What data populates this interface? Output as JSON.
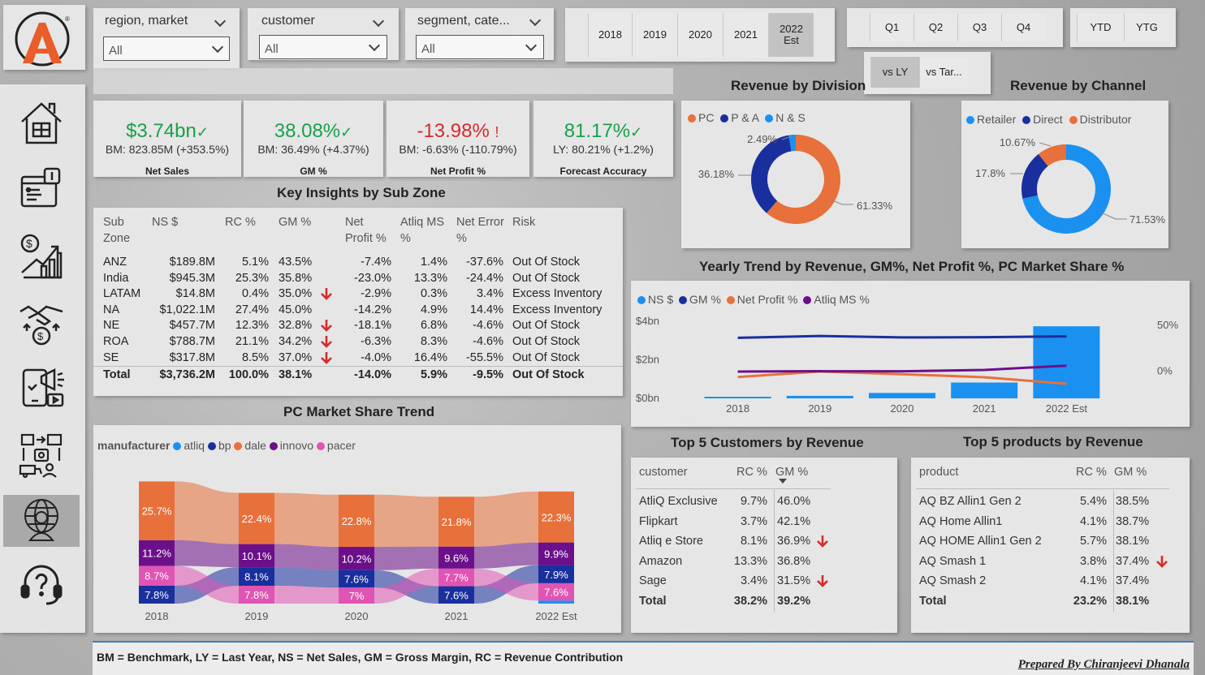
{
  "filters": [
    {
      "label": "region, market",
      "value": "All"
    },
    {
      "label": "customer",
      "value": "All"
    },
    {
      "label": "segment, cate...",
      "value": "All"
    }
  ],
  "years": [
    {
      "label": "2018"
    },
    {
      "label": "2019"
    },
    {
      "label": "2020"
    },
    {
      "label": "2021"
    },
    {
      "label": "2022 Est",
      "selected": true
    }
  ],
  "quarters": [
    "Q1",
    "Q2",
    "Q3",
    "Q4"
  ],
  "ytd": [
    "YTD",
    "YTG"
  ],
  "compare": [
    {
      "label": "vs LY",
      "selected": true
    },
    {
      "label": "vs Tar..."
    }
  ],
  "kpis": [
    {
      "value": "$3.74bn",
      "mark": "✓",
      "sub": "BM: 823.85M (+353.5%)",
      "label": "Net Sales",
      "color": "#17a24a"
    },
    {
      "value": "38.08%",
      "mark": "✓",
      "sub": "BM: 36.49% (+4.37%)",
      "label": "GM %",
      "color": "#17a24a"
    },
    {
      "value": "-13.98%",
      "mark": "!",
      "sub": "BM: -6.63% (-110.79%)",
      "label": "Net Profit %",
      "color": "#d62b2b"
    },
    {
      "value": "81.17%",
      "mark": "✓",
      "sub": "LY: 80.21% (+1.2%)",
      "label": "Forecast Accuracy",
      "color": "#17a24a"
    }
  ],
  "insights": {
    "title": "Key Insights by Sub Zone",
    "headers": [
      "Sub Zone",
      "NS $",
      "RC %",
      "GM %",
      "Net Profit %",
      "Atliq MS %",
      "Net Error %",
      "Risk"
    ],
    "rows": [
      {
        "zone": "ANZ",
        "ns": "$189.8M",
        "rc": "5.1%",
        "gm": "43.5%",
        "np": "-7.4%",
        "ms": "1.4%",
        "ne": "-37.6%",
        "risk": "Out Of Stock",
        "arrow": false
      },
      {
        "zone": "India",
        "ns": "$945.3M",
        "rc": "25.3%",
        "gm": "35.8%",
        "np": "-23.0%",
        "ms": "13.3%",
        "ne": "-24.4%",
        "risk": "Out Of Stock",
        "arrow": false
      },
      {
        "zone": "LATAM",
        "ns": "$14.8M",
        "rc": "0.4%",
        "gm": "35.0%",
        "np": "-2.9%",
        "ms": "0.3%",
        "ne": "3.4%",
        "risk": "Excess Inventory",
        "arrow": true
      },
      {
        "zone": "NA",
        "ns": "$1,022.1M",
        "rc": "27.4%",
        "gm": "45.0%",
        "np": "-14.2%",
        "ms": "4.9%",
        "ne": "14.4%",
        "risk": "Excess Inventory",
        "arrow": false
      },
      {
        "zone": "NE",
        "ns": "$457.7M",
        "rc": "12.3%",
        "gm": "32.8%",
        "np": "-18.1%",
        "ms": "6.8%",
        "ne": "-4.6%",
        "risk": "Out Of Stock",
        "arrow": true
      },
      {
        "zone": "ROA",
        "ns": "$788.7M",
        "rc": "21.1%",
        "gm": "34.2%",
        "np": "-6.3%",
        "ms": "8.3%",
        "ne": "-4.6%",
        "risk": "Out Of Stock",
        "arrow": true
      },
      {
        "zone": "SE",
        "ns": "$317.8M",
        "rc": "8.5%",
        "gm": "37.0%",
        "np": "-4.0%",
        "ms": "16.4%",
        "ne": "-55.5%",
        "risk": "Out Of Stock",
        "arrow": true
      }
    ],
    "total": {
      "zone": "Total",
      "ns": "$3,736.2M",
      "rc": "100.0%",
      "gm": "38.1%",
      "np": "-14.0%",
      "ms": "5.9%",
      "ne": "-9.5%",
      "risk": "Out Of Stock"
    }
  },
  "rev_div": {
    "title": "Revenue by Division"
  },
  "rev_ch": {
    "title": "Revenue by Channel"
  },
  "trend": {
    "title": "Yearly Trend by Revenue, GM%, Net Profit %, PC Market  Share %"
  },
  "share": {
    "title": "PC Market Share Trend",
    "legend_title": "manufacturer"
  },
  "top_customers": {
    "title": "Top 5 Customers by Revenue",
    "headers": [
      "customer",
      "RC %",
      "GM %"
    ],
    "rows": [
      {
        "name": "AtliQ Exclusive",
        "rc": "9.7%",
        "gm": "46.0%",
        "arrow": false
      },
      {
        "name": "Flipkart",
        "rc": "3.7%",
        "gm": "42.1%",
        "arrow": false
      },
      {
        "name": "Atliq e Store",
        "rc": "8.1%",
        "gm": "36.9%",
        "arrow": true
      },
      {
        "name": "Amazon",
        "rc": "13.3%",
        "gm": "36.8%",
        "arrow": false
      },
      {
        "name": "Sage",
        "rc": "3.4%",
        "gm": "31.5%",
        "arrow": true
      }
    ],
    "total": {
      "name": "Total",
      "rc": "38.2%",
      "gm": "39.2%"
    }
  },
  "top_products": {
    "title": "Top 5 products by Revenue",
    "headers": [
      "product",
      "RC %",
      "GM %"
    ],
    "rows": [
      {
        "name": "AQ BZ Allin1 Gen 2",
        "rc": "5.4%",
        "gm": "38.5%",
        "arrow": false
      },
      {
        "name": "AQ Home Allin1",
        "rc": "4.1%",
        "gm": "38.7%",
        "arrow": false
      },
      {
        "name": "AQ HOME Allin1 Gen 2",
        "rc": "5.7%",
        "gm": "38.1%",
        "arrow": false
      },
      {
        "name": "AQ Smash 1",
        "rc": "3.8%",
        "gm": "37.4%",
        "arrow": true
      },
      {
        "name": "AQ Smash 2",
        "rc": "4.1%",
        "gm": "37.4%",
        "arrow": false
      }
    ],
    "total": {
      "name": "Total",
      "rc": "23.2%",
      "gm": "38.1%"
    }
  },
  "footer": {
    "glossary": "BM = Benchmark, LY = Last Year, NS = Net Sales, GM = Gross Margin, RC = Revenue Contribution",
    "credit": "Prepared By Chiranjeevi Dhanala"
  },
  "nav_icons": [
    "home-icon",
    "report-icon",
    "finance-growth-icon",
    "partnership-money-icon",
    "marketing-icon",
    "supply-chain-icon",
    "executive-globe-icon",
    "help-headset-icon"
  ],
  "chart_data": [
    {
      "type": "pie",
      "title": "Revenue by Division",
      "labels": [
        "PC",
        "P & A",
        "N & S"
      ],
      "values": [
        61.33,
        36.18,
        2.49
      ],
      "colors": [
        "#e8703a",
        "#1a2f9e",
        "#1a90f0"
      ],
      "legend_position": "top-left"
    },
    {
      "type": "pie",
      "title": "Revenue by Channel",
      "labels": [
        "Retailer",
        "Direct",
        "Distributor"
      ],
      "values": [
        71.53,
        17.8,
        10.67
      ],
      "colors": [
        "#1a90f0",
        "#1a2f9e",
        "#e8703a"
      ],
      "legend_position": "top-left"
    },
    {
      "type": "bar",
      "title": "Yearly Trend by Revenue, GM%, Net Profit %, PC Market  Share %",
      "categories": [
        "2018",
        "2019",
        "2020",
        "2021",
        "2022 Est"
      ],
      "y_ticks": [
        "$0bn",
        "$2bn",
        "$4bn"
      ],
      "y2_ticks": [
        "0%",
        "50%"
      ],
      "ylim": [
        0,
        4
      ],
      "y2lim": [
        -30,
        60
      ],
      "series": [
        {
          "name": "NS $",
          "type": "bar",
          "color": "#1a90f0",
          "values": [
            0.05,
            0.13,
            0.28,
            0.82,
            3.74
          ]
        },
        {
          "name": "GM %",
          "type": "line",
          "color": "#1a2f9e",
          "values": [
            36.5,
            38.5,
            36.9,
            37.2,
            38.1
          ]
        },
        {
          "name": "Net Profit %",
          "type": "line",
          "color": "#e8703a",
          "values": [
            -6.6,
            -0.5,
            -3.5,
            -6.8,
            -14.0
          ]
        },
        {
          "name": "Atliq MS %",
          "type": "line",
          "color": "#6b0f8a",
          "values": [
            -0.6,
            -0.2,
            -0.3,
            1.2,
            5.9
          ]
        }
      ],
      "legend_position": "top-left"
    },
    {
      "type": "area",
      "title": "PC Market Share Trend",
      "categories": [
        "2018",
        "2019",
        "2020",
        "2021",
        "2022 Est"
      ],
      "legend_title": "manufacturer",
      "series": [
        {
          "name": "pacer",
          "color": "#e055b4",
          "values": [
            8.7,
            7.8,
            7.0,
            7.7,
            7.6
          ]
        },
        {
          "name": "atliq",
          "color": "#1a90f0",
          "values": [
            null,
            null,
            null,
            null,
            null
          ]
        },
        {
          "name": "bp",
          "color": "#1a2f9e",
          "values": [
            7.8,
            8.1,
            7.6,
            7.6,
            7.9
          ]
        },
        {
          "name": "dale",
          "color": "#e8703a",
          "values": [
            25.7,
            22.4,
            22.8,
            21.8,
            22.3
          ]
        },
        {
          "name": "innovo",
          "color": "#6b0f8a",
          "values": [
            11.2,
            10.1,
            10.2,
            9.6,
            9.9
          ]
        }
      ],
      "legend_position": "top-left"
    }
  ]
}
